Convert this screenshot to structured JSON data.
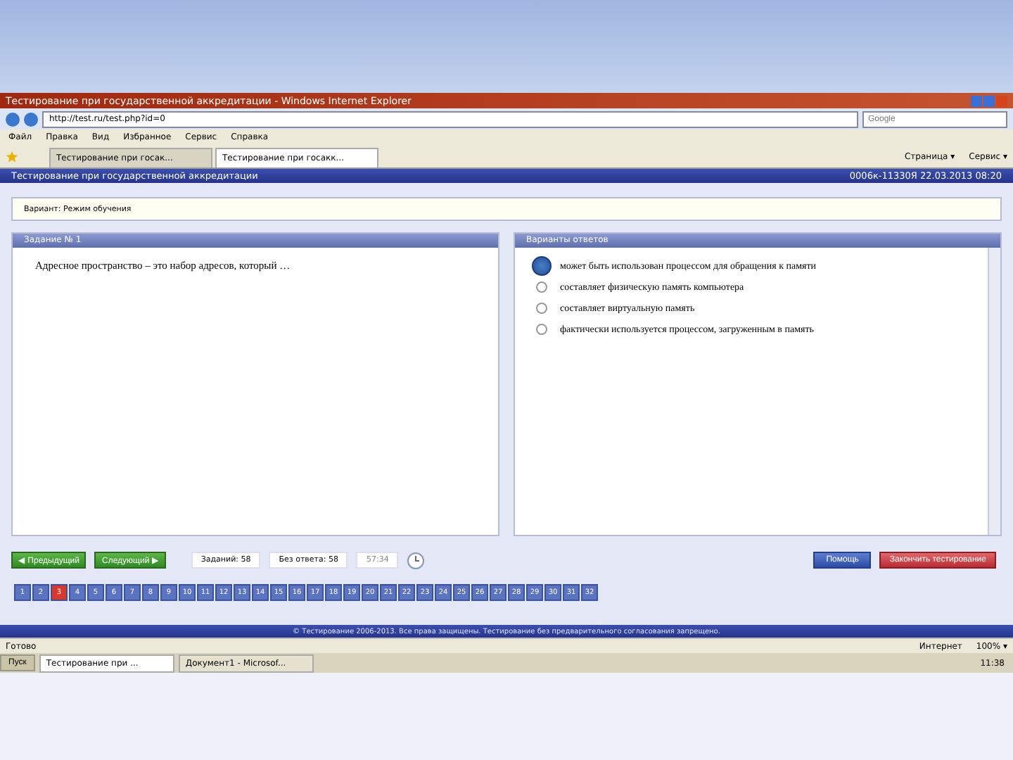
{
  "window": {
    "title": "Тестирование при государственной аккредитации - Windows Internet Explorer"
  },
  "address": {
    "value": "http://test.ru/test.php?id=0"
  },
  "search": {
    "placeholder": "Google"
  },
  "menu": [
    "Файл",
    "Правка",
    "Вид",
    "Избранное",
    "Сервис",
    "Справка"
  ],
  "tabs": [
    {
      "label": "Тестирование при госак...",
      "selected": false
    },
    {
      "label": "Тестирование при госакк...",
      "selected": true
    }
  ],
  "toolbar": [
    "Страница ▾",
    "Сервис ▾"
  ],
  "page": {
    "title": "Тестирование при государственной аккредитации",
    "session": "0006к-11330Я 22.03.2013 08:20",
    "mode": "Вариант: Режим обучения"
  },
  "task": {
    "header": "Задание № 1",
    "text": "Адресное пространство – это набор адресов, который …"
  },
  "answers": {
    "header": "Варианты ответов",
    "options": [
      {
        "label": "может быть использован процессом для обращения к памяти",
        "selected": true
      },
      {
        "label": "составляет физическую память компьютера",
        "selected": false
      },
      {
        "label": "составляет виртуальную память",
        "selected": false
      },
      {
        "label": "фактически используется процессом, загруженным в память",
        "selected": false
      }
    ]
  },
  "nav": {
    "prev": "◀ Предыдущий",
    "next": "Следующий ▶",
    "total": "Заданий: 58",
    "unanswered": "Без ответа: 58",
    "timer": "57:34",
    "help": "Помощь",
    "finish": "Закончить тестирование"
  },
  "questions": [
    {
      "label": "1",
      "selected": false
    },
    {
      "label": "2",
      "selected": false
    },
    {
      "label": "3",
      "selected": true
    },
    {
      "label": "4",
      "selected": false
    },
    {
      "label": "5",
      "selected": false
    },
    {
      "label": "6",
      "selected": false
    },
    {
      "label": "7",
      "selected": false
    },
    {
      "label": "8",
      "selected": false
    },
    {
      "label": "9",
      "selected": false
    },
    {
      "label": "10",
      "selected": false
    },
    {
      "label": "11",
      "selected": false
    },
    {
      "label": "12",
      "selected": false
    },
    {
      "label": "13",
      "selected": false
    },
    {
      "label": "14",
      "selected": false
    },
    {
      "label": "15",
      "selected": false
    },
    {
      "label": "16",
      "selected": false
    },
    {
      "label": "17",
      "selected": false
    },
    {
      "label": "18",
      "selected": false
    },
    {
      "label": "19",
      "selected": false
    },
    {
      "label": "20",
      "selected": false
    },
    {
      "label": "21",
      "selected": false
    },
    {
      "label": "22",
      "selected": false
    },
    {
      "label": "23",
      "selected": false
    },
    {
      "label": "24",
      "selected": false
    },
    {
      "label": "25",
      "selected": false
    },
    {
      "label": "26",
      "selected": false
    },
    {
      "label": "27",
      "selected": false
    },
    {
      "label": "28",
      "selected": false
    },
    {
      "label": "29",
      "selected": false
    },
    {
      "label": "30",
      "selected": false
    },
    {
      "label": "31",
      "selected": false
    },
    {
      "label": "32",
      "selected": false
    }
  ],
  "footer": "© Тестирование 2006-2013. Все права защищены. Тестирование без предварительного согласования запрещено.",
  "status_bar": {
    "text": "Готово",
    "zone": "Интернет",
    "zoom": "100% ▾"
  },
  "taskbar": {
    "start": "Пуск",
    "items": [
      {
        "label": "Тестирование при ...",
        "selected": true
      },
      {
        "label": "Документ1 - Microsof...",
        "selected": false
      }
    ],
    "clock": "11:38"
  }
}
